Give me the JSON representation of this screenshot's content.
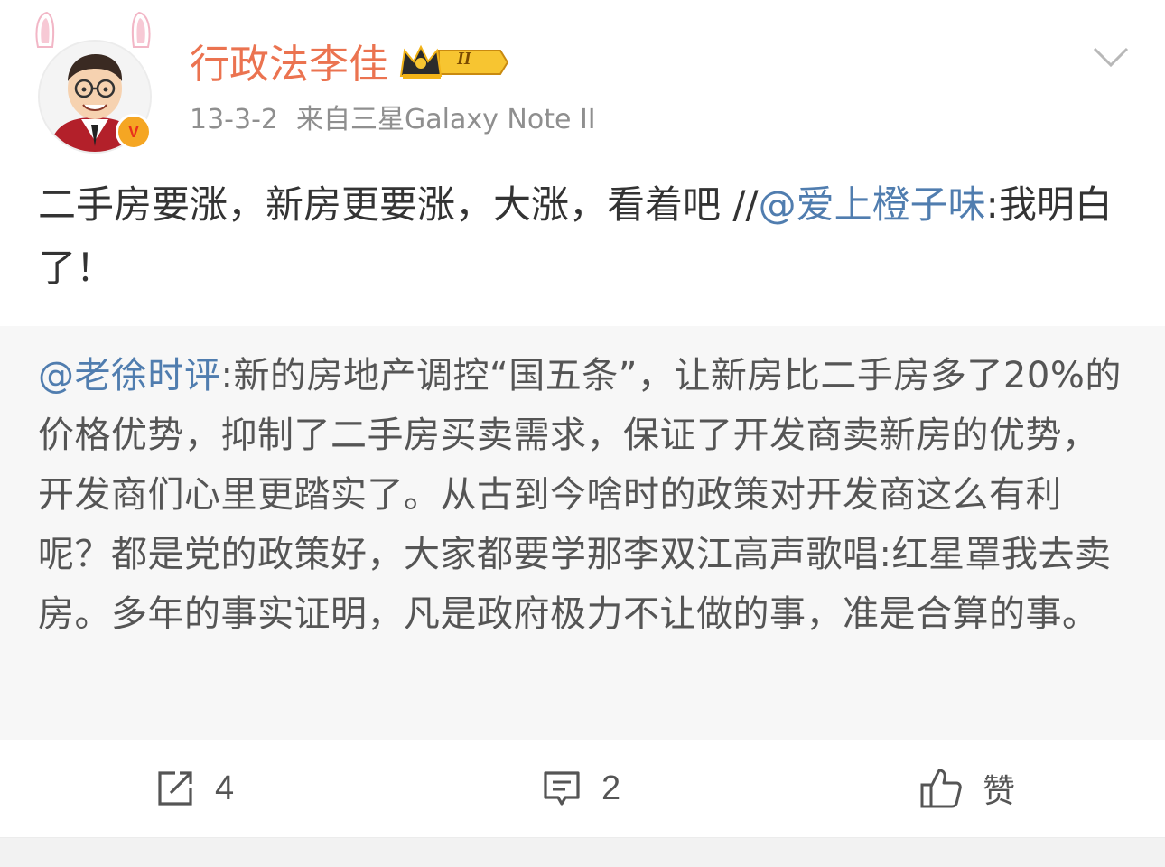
{
  "user": {
    "name": "行政法李佳",
    "level_badge": "II",
    "verified_icon": "v-verified-badge",
    "avatar_icon": "avatar-with-bunny-ears"
  },
  "meta": {
    "date": "13-3-2",
    "source": "来自三星Galaxy Note II"
  },
  "post": {
    "text_lead": "二手房要涨，新房更要涨，大涨，看着吧 //",
    "mention": "@爱上橙子味",
    "text_tail": ":我明白了！"
  },
  "quoted": {
    "mention": "@老徐时评",
    "text": ":新的房地产调控“国五条”，让新房比二手房多了20%的价格优势，抑制了二手房买卖需求，保证了开发商卖新房的优势，开发商们心里更踏实了。从古到今啥时的政策对开发商这么有利呢？都是党的政策好，大家都要学那李双江高声歌唱:红星罩我去卖房。多年的事实证明，凡是政府极力不让做的事，准是合算的事。"
  },
  "actions": {
    "repost_count": "4",
    "comment_count": "2",
    "like_label": "赞"
  },
  "colors": {
    "username": "#eb7350",
    "mention": "#507daf",
    "meta": "#8f8f8f",
    "quoted_bg": "#f7f7f7"
  }
}
